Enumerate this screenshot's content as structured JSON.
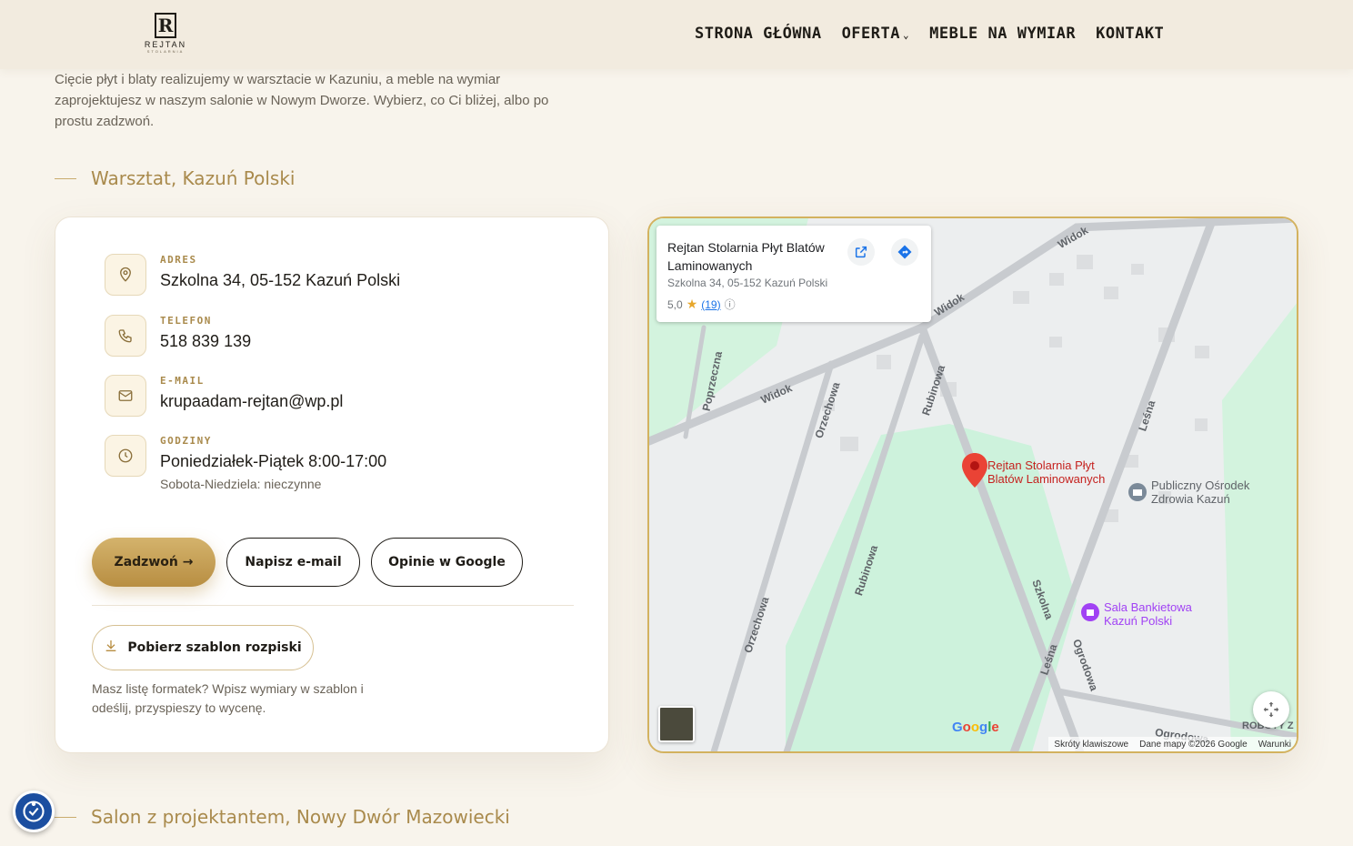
{
  "header": {
    "logo": {
      "text": "REJTAN",
      "sub": "STOLARNIA",
      "mark": "R"
    },
    "nav": [
      {
        "label": "STRONA GŁÓWNA"
      },
      {
        "label": "OFERTA"
      },
      {
        "label": "MEBLE NA WYMIAR"
      },
      {
        "label": "KONTAKT"
      }
    ]
  },
  "intro": "Cięcie płyt i blaty realizujemy w warsztacie w Kazuniu, a meble na wymiar zaprojektujesz w naszym salonie w Nowym Dworze. Wybierz, co Ci bliżej, albo po prostu zadzwoń.",
  "workshop": {
    "title": "Warsztat, Kazuń Polski",
    "address_label": "ADRES",
    "address": "Szkolna 34, 05-152 Kazuń Polski",
    "phone_label": "TELEFON",
    "phone": "518 839 139",
    "email_label": "E-MAIL",
    "email": "krupaadam-rejtan@wp.pl",
    "hours_label": "GODZINY",
    "hours": "Poniedziałek-Piątek 8:00-17:00",
    "hours_weekend": "Sobota-Niedziela: nieczynne",
    "buttons": {
      "call": "Zadzwoń →",
      "email": "Napisz e-mail",
      "reviews": "Opinie w Google"
    },
    "download": "Pobierz szablon rozpiski",
    "note": "Masz listę formatek? Wpisz wymiary w szablon i odeślij, przyspieszy to wycenę."
  },
  "map": {
    "card": {
      "title": "Rejtan Stolarnia Płyt Blatów Laminowanych",
      "address": "Szkolna 34, 05-152 Kazuń Polski",
      "rating": "5,0",
      "count": "(19)"
    },
    "roads": [
      "Widok",
      "Widok",
      "Widok",
      "Poprzeczna",
      "Orzechowa",
      "Rubinowa",
      "Rubinowa",
      "Orzechowa",
      "Leśna",
      "Szkolna",
      "Leśna",
      "Ogrodowa",
      "Ogrodowa",
      "ROBOTY Z WYBUR"
    ],
    "pin_label": "Rejtan Stolarnia Płyt Blatów Laminowanych",
    "poi1": "Publiczny Ośrodek Zdrowia Kazuń",
    "poi2": "Sala Bankietowa Kazuń Polski",
    "google": "Google",
    "footer": [
      "Skróty klawiszowe",
      "Dane mapy ©2026 Google",
      "Warunki"
    ]
  },
  "salon": {
    "title": "Salon z projektantem, Nowy Dwór Mazowiecki"
  },
  "colors": {
    "accent": "#a98a4c",
    "gold": "#d3b25f",
    "background": "#f8f4ec"
  }
}
